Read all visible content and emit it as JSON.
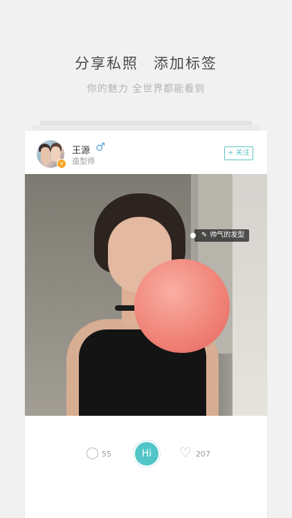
{
  "intro": {
    "headline_left": "分享私照",
    "headline_right": "添加标签",
    "subline": "你的魅力 全世界都能看到"
  },
  "post": {
    "username": "王源",
    "gender_symbol": "♂",
    "role": "造型师",
    "verified_badge": "v",
    "follow_label": "+ 关注",
    "photo_tag": "帅气的发型",
    "comment_count": "55",
    "hi_label": "Hi",
    "like_count": "207"
  },
  "icons": {
    "comment": "comment-icon",
    "like": "heart-icon",
    "edit": "pencil-icon"
  },
  "colors": {
    "accent": "#51c5c8",
    "gender": "#5aa9e0",
    "verified": "#f5a623"
  }
}
